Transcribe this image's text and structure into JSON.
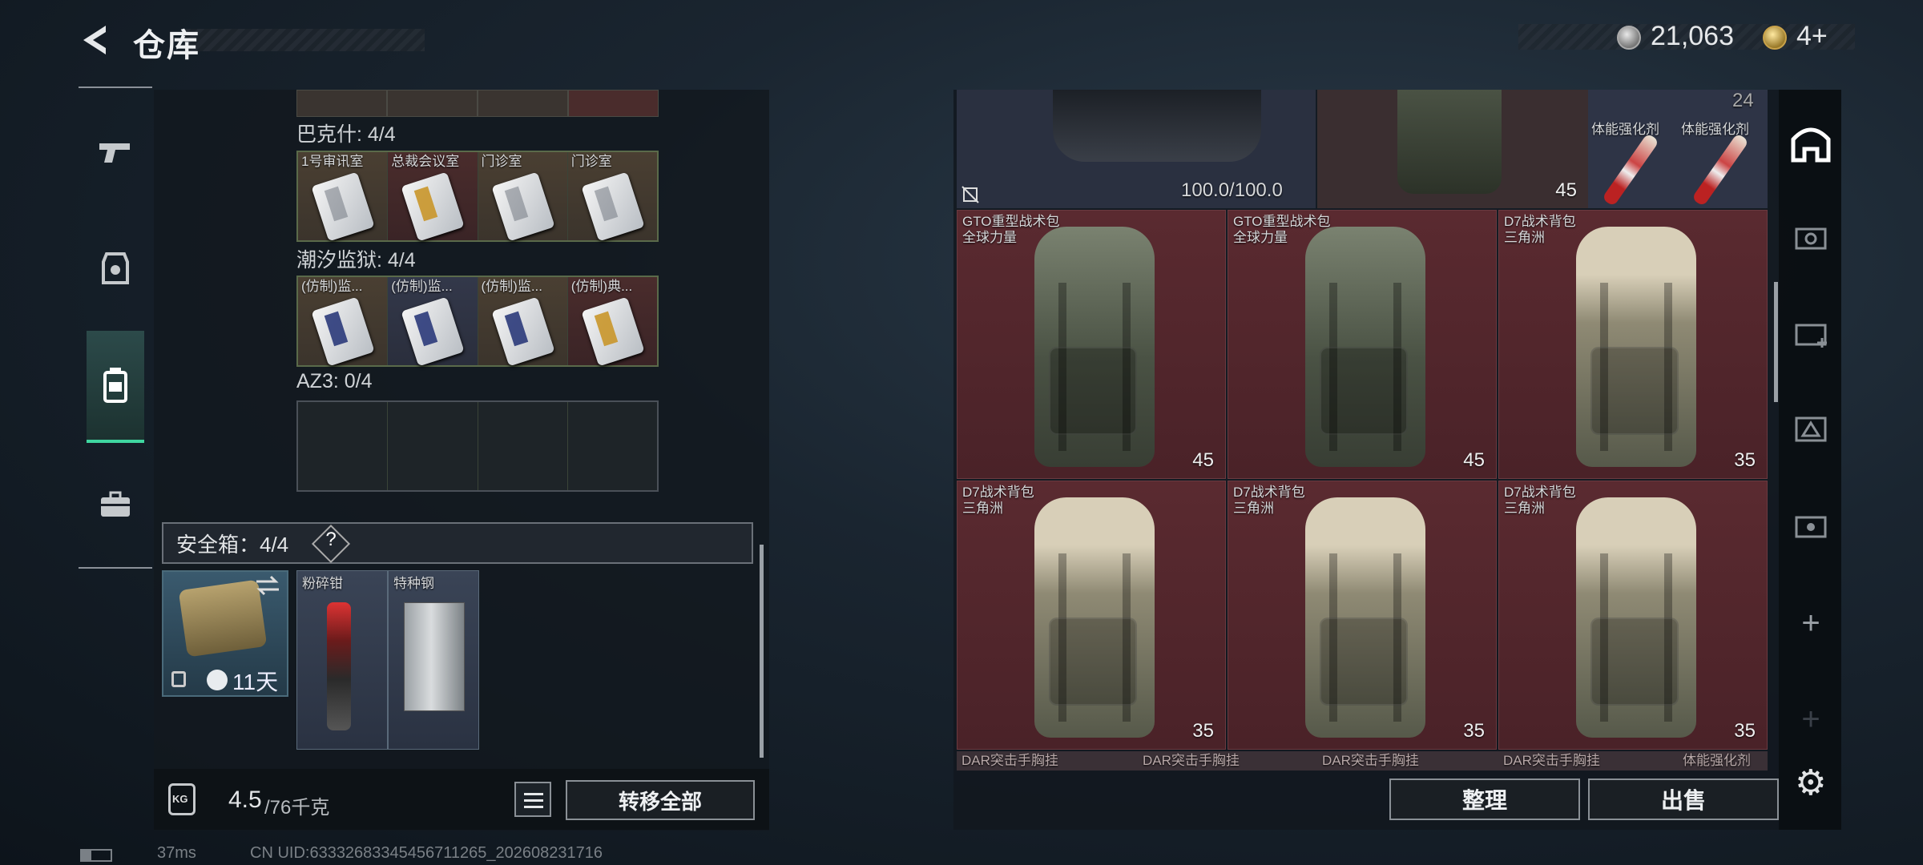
{
  "header": {
    "title": "仓库",
    "silver": "21,063",
    "gold": "4+"
  },
  "left": {
    "sections": [
      {
        "name": "巴克什: 4/4",
        "cells": [
          "1号审讯室",
          "总裁会议室",
          "门诊室",
          "门诊室"
        ]
      },
      {
        "name": "潮汐监狱: 4/4",
        "cells": [
          "(仿制)监...",
          "(仿制)监...",
          "(仿制)监...",
          "(仿制)典..."
        ]
      },
      {
        "name": "AZ3: 0/4"
      }
    ],
    "safe": {
      "label": "安全箱：4/4",
      "help": "?",
      "timer": "11天"
    },
    "items": [
      "粉碎钳",
      "特种钢"
    ],
    "kg_badge": "KG",
    "weight": {
      "current": "4.5",
      "max": "/76千克"
    },
    "transfer_label": "转移全部"
  },
  "right": {
    "top": {
      "durability": "100.0/100.0",
      "cap1": "45",
      "stack": "24",
      "inj1": "体能强化剂",
      "inj2": "体能强化剂"
    },
    "packs": [
      {
        "name": "GTO重型战术包",
        "sub": "全球力量",
        "cap": "45",
        "color": "green"
      },
      {
        "name": "GTO重型战术包",
        "sub": "全球力量",
        "cap": "45",
        "color": "green"
      },
      {
        "name": "D7战术背包",
        "sub": "三角洲",
        "cap": "35",
        "color": "tan"
      },
      {
        "name": "D7战术背包",
        "sub": "三角洲",
        "cap": "35",
        "color": "tan"
      },
      {
        "name": "D7战术背包",
        "sub": "三角洲",
        "cap": "35",
        "color": "tan"
      },
      {
        "name": "D7战术背包",
        "sub": "三角洲",
        "cap": "35",
        "color": "tan"
      }
    ],
    "bottom": [
      "DAR突击手胸挂",
      "DAR突击手胸挂",
      "DAR突击手胸挂",
      "DAR突击手胸挂",
      "体能强化剂"
    ],
    "sort_label": "整理",
    "sell_label": "出售"
  },
  "status": {
    "ping": "37ms",
    "uid": "CN UID:6333268334545671126​5_202608231716"
  },
  "colors": {
    "accent": "#3fd6a0",
    "cell_red": "#5a2a30"
  }
}
